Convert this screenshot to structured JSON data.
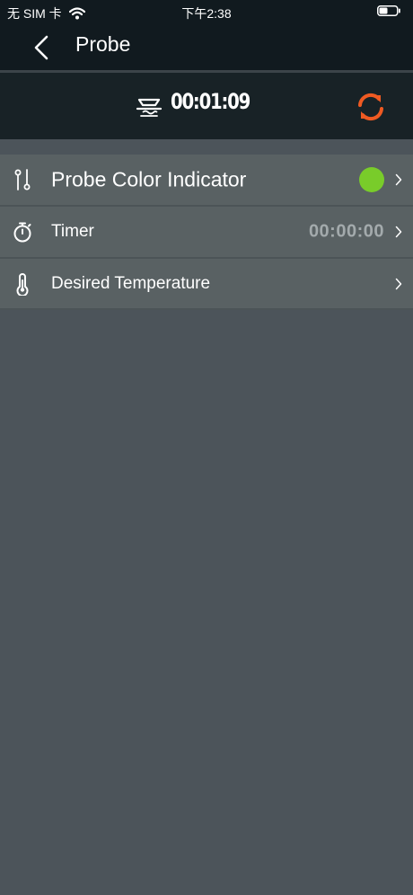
{
  "status_bar": {
    "carrier": "无 SIM 卡",
    "time": "下午2:38"
  },
  "nav": {
    "title": "Probe"
  },
  "timer_bar": {
    "elapsed": "00:01:09"
  },
  "rows": [
    {
      "label": "Probe Color Indicator",
      "icon": "probe-icon",
      "color": "#79cc2a"
    },
    {
      "label": "Timer",
      "icon": "stopwatch-icon",
      "value": "00:00:00"
    },
    {
      "label": "Desired Temperature",
      "icon": "thermometer-icon"
    }
  ],
  "colors": {
    "accent": "#ef5a22",
    "background": "#4c545a",
    "row": "#596163",
    "header": "#111a1f"
  }
}
